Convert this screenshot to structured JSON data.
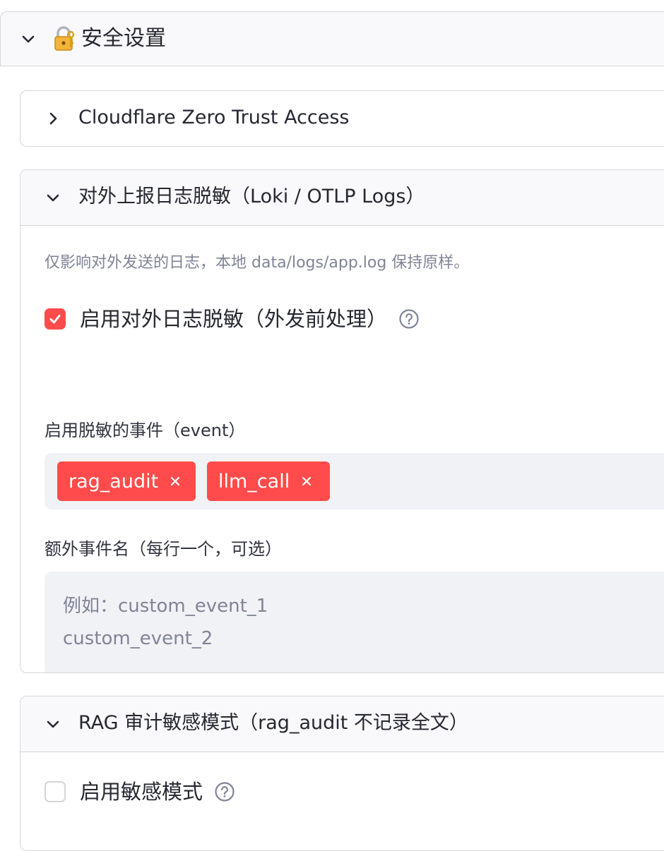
{
  "security": {
    "title": "安全设置",
    "lock_icon": "lock-with-key-icon"
  },
  "cloudflare": {
    "title": "Cloudflare Zero Trust Access"
  },
  "log_masking": {
    "title": "对外上报日志脱敏（Loki / OTLP Logs）",
    "caption": "仅影响对外发送的日志，本地 data/logs/app.log 保持原样。",
    "enable_label": "启用对外日志脱敏（外发前处理）",
    "enable_checked": true,
    "events_label": "启用脱敏的事件（event）",
    "events": [
      {
        "label": "rag_audit"
      },
      {
        "label": "llm_call"
      }
    ],
    "extra_label": "额外事件名（每行一个，可选）",
    "extra_placeholder": "例如：custom_event_1\ncustom_event_2",
    "accent_color": "#ff4b4b"
  },
  "rag_audit": {
    "title": "RAG 审计敏感模式（rag_audit 不记录全文）",
    "enable_label": "启用敏感模式",
    "enable_checked": false
  }
}
